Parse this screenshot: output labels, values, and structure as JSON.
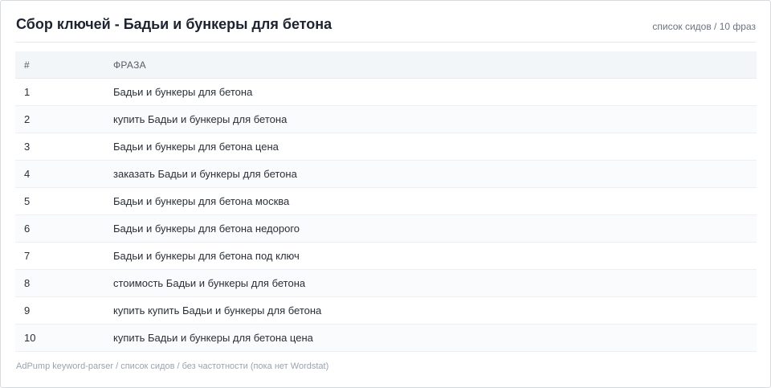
{
  "header": {
    "title": "Сбор ключей - Бадьи и бункеры для бетона",
    "subtitle": "список сидов / 10 фраз"
  },
  "table": {
    "columns": [
      "#",
      "ФРАЗА"
    ],
    "rows": [
      {
        "num": "1",
        "phrase": "Бадьи и бункеры для бетона"
      },
      {
        "num": "2",
        "phrase": "купить Бадьи и бункеры для бетона"
      },
      {
        "num": "3",
        "phrase": "Бадьи и бункеры для бетона цена"
      },
      {
        "num": "4",
        "phrase": "заказать Бадьи и бункеры для бетона"
      },
      {
        "num": "5",
        "phrase": "Бадьи и бункеры для бетона москва"
      },
      {
        "num": "6",
        "phrase": "Бадьи и бункеры для бетона недорого"
      },
      {
        "num": "7",
        "phrase": "Бадьи и бункеры для бетона под ключ"
      },
      {
        "num": "8",
        "phrase": "стоимость Бадьи и бункеры для бетона"
      },
      {
        "num": "9",
        "phrase": "купить купить Бадьи и бункеры для бетона"
      },
      {
        "num": "10",
        "phrase": "купить Бадьи и бункеры для бетона цена"
      }
    ]
  },
  "footer": {
    "text": "AdPump keyword-parser / список сидов / без частотности (пока нет Wordstat)"
  }
}
